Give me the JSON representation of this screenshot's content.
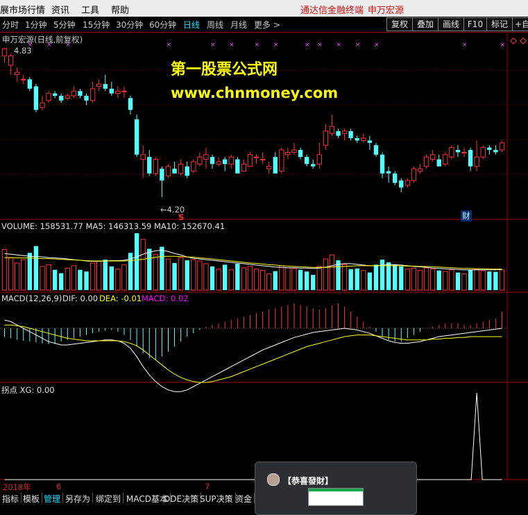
{
  "menubar": {
    "items": [
      "展市场行情",
      "资讯",
      "工具",
      "帮助"
    ],
    "right_items": [
      "通达信金融终端",
      "申万宏源"
    ]
  },
  "periods": {
    "items": [
      "分时",
      "1分钟",
      "5分钟",
      "15分钟",
      "30分钟",
      "60分钟",
      "日线",
      "周线",
      "月线",
      "更多 >"
    ],
    "active": "日线"
  },
  "right_buttons": [
    "复权",
    "叠加",
    "画线",
    "F10",
    "标记",
    "+自选"
  ],
  "price_panel": {
    "title": "申万宏源(日线,前复权)",
    "high_label": "4.83",
    "low_label": "←4.20",
    "s_marker": "S",
    "cai_badge": "财"
  },
  "watermark": {
    "line1": "第一股票公式网",
    "line2": "www.chnmoney.com"
  },
  "volume_panel": {
    "label": "VOLUME: 158531.77  MA5: 146313.59  MA10: 152670.41"
  },
  "macd_panel": {
    "name": "MACD(12,26,9)",
    "dif": "DIF: 0.00",
    "dea": "DEA: -0.01",
    "macd": "MACD: 0.02"
  },
  "xg_panel": {
    "label": "拐点  XG: 0.00"
  },
  "date_axis": {
    "year": "2018年",
    "month1": "6",
    "month2": "7"
  },
  "bottom_tabs": [
    "指标",
    "模板",
    "管理",
    "另存为",
    "绑定到",
    "MACD基本",
    "DDE决策",
    "SUP决策",
    "资金"
  ],
  "bottom_active": "管理",
  "popup": {
    "title": "【恭喜發財】"
  },
  "colors": {
    "up": "#ff3232",
    "down": "#54ffff",
    "ma5": "#ffffff",
    "ma10": "#ffff00",
    "macd_label": "#ff00ff",
    "grid": "#a00000"
  },
  "chart_data": {
    "type": "candlestick",
    "candles": [
      [
        4.8,
        4.83,
        4.82,
        4.77
      ],
      [
        4.76,
        4.8,
        4.81,
        4.72
      ],
      [
        4.72,
        4.73,
        4.75,
        4.69
      ],
      [
        4.7,
        4.7,
        4.72,
        4.68
      ],
      [
        4.7,
        4.66,
        4.71,
        4.65
      ],
      [
        4.67,
        4.57,
        4.68,
        4.56
      ],
      [
        4.58,
        4.6,
        4.63,
        4.57
      ],
      [
        4.61,
        4.64,
        4.65,
        4.6
      ],
      [
        4.64,
        4.63,
        4.65,
        4.62
      ],
      [
        4.63,
        4.61,
        4.64,
        4.6
      ],
      [
        4.62,
        4.63,
        4.64,
        4.61
      ],
      [
        4.63,
        4.65,
        4.67,
        4.62
      ],
      [
        4.65,
        4.63,
        4.66,
        4.62
      ],
      [
        4.63,
        4.61,
        4.64,
        4.59
      ],
      [
        4.61,
        4.66,
        4.69,
        4.6
      ],
      [
        4.67,
        4.68,
        4.7,
        4.65
      ],
      [
        4.68,
        4.66,
        4.72,
        4.65
      ],
      [
        4.66,
        4.64,
        4.69,
        4.63
      ],
      [
        4.64,
        4.65,
        4.67,
        4.62
      ],
      [
        4.65,
        4.65,
        4.67,
        4.62
      ],
      [
        4.62,
        4.57,
        4.63,
        4.55
      ],
      [
        4.53,
        4.38,
        4.55,
        4.37
      ],
      [
        4.36,
        4.38,
        4.42,
        4.28
      ],
      [
        4.37,
        4.3,
        4.4,
        4.29
      ],
      [
        4.3,
        4.36,
        4.37,
        4.29
      ],
      [
        4.32,
        4.27,
        4.33,
        4.2
      ],
      [
        4.29,
        4.33,
        4.34,
        4.28
      ],
      [
        4.32,
        4.3,
        4.35,
        4.3
      ],
      [
        4.3,
        4.34,
        4.36,
        4.29
      ],
      [
        4.33,
        4.29,
        4.35,
        4.28
      ],
      [
        4.31,
        4.35,
        4.36,
        4.3
      ],
      [
        4.34,
        4.37,
        4.39,
        4.33
      ],
      [
        4.36,
        4.38,
        4.41,
        4.32
      ],
      [
        4.37,
        4.34,
        4.38,
        4.32
      ],
      [
        4.34,
        4.35,
        4.37,
        4.33
      ],
      [
        4.36,
        4.34,
        4.37,
        4.31
      ],
      [
        4.34,
        4.37,
        4.38,
        4.32
      ],
      [
        4.36,
        4.3,
        4.37,
        4.3
      ],
      [
        4.31,
        4.34,
        4.36,
        4.31
      ],
      [
        4.33,
        4.38,
        4.39,
        4.33
      ],
      [
        4.37,
        4.37,
        4.38,
        4.34
      ],
      [
        4.36,
        4.36,
        4.39,
        4.34
      ],
      [
        4.32,
        4.33,
        4.35,
        4.3
      ],
      [
        4.37,
        4.3,
        4.39,
        4.3
      ],
      [
        4.31,
        4.4,
        4.41,
        4.3
      ],
      [
        4.38,
        4.39,
        4.41,
        4.36
      ],
      [
        4.39,
        4.4,
        4.43,
        4.38
      ],
      [
        4.4,
        4.37,
        4.41,
        4.36
      ],
      [
        4.37,
        4.34,
        4.38,
        4.33
      ],
      [
        4.34,
        4.33,
        4.36,
        4.32
      ],
      [
        4.34,
        4.38,
        4.43,
        4.32
      ],
      [
        4.42,
        4.48,
        4.51,
        4.4
      ],
      [
        4.47,
        4.5,
        4.55,
        4.46
      ],
      [
        4.48,
        4.46,
        4.49,
        4.45
      ],
      [
        4.47,
        4.48,
        4.49,
        4.44
      ],
      [
        4.48,
        4.45,
        4.49,
        4.44
      ],
      [
        4.45,
        4.44,
        4.46,
        4.43
      ],
      [
        4.44,
        4.45,
        4.47,
        4.43
      ],
      [
        4.44,
        4.43,
        4.46,
        4.4
      ],
      [
        4.42,
        4.38,
        4.43,
        4.37
      ],
      [
        4.38,
        4.3,
        4.39,
        4.28
      ],
      [
        4.31,
        4.3,
        4.33,
        4.26
      ],
      [
        4.3,
        4.26,
        4.31,
        4.25
      ],
      [
        4.27,
        4.24,
        4.28,
        4.22
      ],
      [
        4.25,
        4.27,
        4.28,
        4.24
      ],
      [
        4.27,
        4.32,
        4.33,
        4.26
      ],
      [
        4.31,
        4.32,
        4.34,
        4.3
      ],
      [
        4.33,
        4.37,
        4.38,
        4.32
      ],
      [
        4.36,
        4.38,
        4.4,
        4.35
      ],
      [
        4.36,
        4.33,
        4.38,
        4.33
      ],
      [
        4.34,
        4.38,
        4.39,
        4.33
      ],
      [
        4.37,
        4.41,
        4.42,
        4.36
      ],
      [
        4.4,
        4.39,
        4.42,
        4.37
      ],
      [
        4.39,
        4.39,
        4.41,
        4.37
      ],
      [
        4.4,
        4.33,
        4.41,
        4.31
      ],
      [
        4.33,
        4.37,
        4.44,
        4.31
      ],
      [
        4.37,
        4.41,
        4.42,
        4.36
      ],
      [
        4.41,
        4.4,
        4.42,
        4.38
      ],
      [
        4.4,
        4.39,
        4.42,
        4.38
      ],
      [
        4.4,
        4.43,
        4.44,
        4.39
      ]
    ],
    "volume": [
      120,
      95,
      80,
      90,
      110,
      130,
      70,
      75,
      60,
      50,
      65,
      72,
      60,
      55,
      80,
      85,
      90,
      70,
      62,
      75,
      110,
      168,
      150,
      122,
      105,
      128,
      92,
      80,
      96,
      88,
      90,
      86,
      78,
      70,
      62,
      75,
      60,
      78,
      66,
      70,
      62,
      58,
      48,
      56,
      72,
      66,
      64,
      60,
      55,
      45,
      70,
      92,
      104,
      88,
      76,
      62,
      64,
      58,
      52,
      75,
      90,
      82,
      76,
      70,
      62,
      65,
      58,
      66,
      62,
      58,
      55,
      60,
      52,
      48,
      60,
      62,
      58,
      55,
      54,
      60
    ],
    "ma5": [
      108,
      106,
      104,
      102,
      100,
      99,
      98,
      96,
      95,
      94,
      92,
      90,
      88,
      86,
      85,
      85,
      86,
      87,
      87,
      88,
      92,
      98,
      106,
      112,
      116,
      118,
      114,
      108,
      104,
      98,
      94,
      92,
      90,
      88,
      86,
      84,
      82,
      80,
      78,
      76,
      74,
      72,
      70,
      68,
      67,
      66,
      66,
      65,
      65,
      64,
      65,
      68,
      72,
      76,
      78,
      78,
      76,
      74,
      72,
      72,
      74,
      75,
      75,
      74,
      72,
      70,
      69,
      67,
      65,
      64,
      63,
      62,
      61,
      60,
      60,
      60,
      60,
      60,
      60,
      61
    ],
    "ma10": [
      96,
      96,
      95,
      95,
      95,
      94,
      93,
      93,
      92,
      91,
      90,
      89,
      88,
      87,
      86,
      86,
      86,
      86,
      86,
      86,
      87,
      89,
      91,
      94,
      97,
      99,
      100,
      100,
      99,
      98,
      97,
      95,
      94,
      92,
      90,
      88,
      86,
      84,
      82,
      80,
      79,
      77,
      75,
      74,
      72,
      71,
      70,
      69,
      68,
      67,
      67,
      67,
      68,
      69,
      70,
      71,
      72,
      72,
      72,
      72,
      72,
      72,
      72,
      72,
      71,
      71,
      70,
      70,
      69,
      68,
      67,
      66,
      65,
      64,
      64,
      63,
      63,
      62,
      62,
      62
    ],
    "macd_hist": [
      -0.01,
      -0.012,
      -0.014,
      -0.015,
      -0.016,
      -0.017,
      -0.018,
      -0.019,
      -0.018,
      -0.016,
      -0.014,
      -0.012,
      -0.01,
      -0.008,
      -0.006,
      -0.004,
      -0.003,
      -0.002,
      -0.004,
      -0.008,
      -0.014,
      -0.022,
      -0.03,
      -0.036,
      -0.038,
      -0.034,
      -0.028,
      -0.022,
      -0.016,
      -0.01,
      -0.006,
      -0.002,
      0.002,
      0.004,
      0.006,
      0.008,
      0.01,
      0.012,
      0.014,
      0.016,
      0.018,
      0.02,
      0.022,
      0.024,
      0.026,
      0.028,
      0.03,
      0.028,
      0.026,
      0.024,
      0.022,
      0.024,
      0.028,
      0.03,
      0.026,
      0.02,
      0.014,
      0.008,
      0.002,
      -0.004,
      -0.01,
      -0.014,
      -0.016,
      -0.016,
      -0.012,
      -0.008,
      -0.004,
      0.0,
      0.002,
      0.004,
      0.006,
      0.006,
      0.006,
      0.004,
      0.004,
      0.006,
      0.008,
      0.01,
      0.012,
      0.02
    ],
    "dif": [
      0.01,
      0.008,
      0.004,
      0.0,
      -0.004,
      -0.008,
      -0.012,
      -0.016,
      -0.018,
      -0.02,
      -0.02,
      -0.019,
      -0.018,
      -0.017,
      -0.016,
      -0.015,
      -0.014,
      -0.014,
      -0.015,
      -0.018,
      -0.024,
      -0.034,
      -0.046,
      -0.056,
      -0.064,
      -0.07,
      -0.074,
      -0.076,
      -0.076,
      -0.074,
      -0.07,
      -0.066,
      -0.062,
      -0.058,
      -0.054,
      -0.05,
      -0.046,
      -0.042,
      -0.038,
      -0.034,
      -0.03,
      -0.026,
      -0.023,
      -0.02,
      -0.017,
      -0.014,
      -0.011,
      -0.009,
      -0.007,
      -0.005,
      -0.004,
      -0.003,
      -0.002,
      -0.001,
      0.0,
      -0.001,
      -0.002,
      -0.004,
      -0.006,
      -0.009,
      -0.012,
      -0.015,
      -0.017,
      -0.018,
      -0.018,
      -0.017,
      -0.016,
      -0.014,
      -0.012,
      -0.01,
      -0.009,
      -0.008,
      -0.007,
      -0.006,
      -0.005,
      -0.004,
      -0.003,
      -0.002,
      -0.001,
      0.0
    ],
    "dea": [
      0.004,
      0.004,
      0.003,
      0.002,
      0.0,
      -0.002,
      -0.004,
      -0.006,
      -0.008,
      -0.01,
      -0.012,
      -0.013,
      -0.014,
      -0.015,
      -0.015,
      -0.015,
      -0.015,
      -0.015,
      -0.015,
      -0.016,
      -0.018,
      -0.021,
      -0.026,
      -0.032,
      -0.038,
      -0.044,
      -0.05,
      -0.055,
      -0.059,
      -0.062,
      -0.064,
      -0.065,
      -0.065,
      -0.064,
      -0.062,
      -0.06,
      -0.058,
      -0.055,
      -0.052,
      -0.049,
      -0.046,
      -0.043,
      -0.04,
      -0.037,
      -0.034,
      -0.031,
      -0.028,
      -0.025,
      -0.022,
      -0.02,
      -0.018,
      -0.016,
      -0.014,
      -0.012,
      -0.01,
      -0.009,
      -0.008,
      -0.008,
      -0.008,
      -0.009,
      -0.01,
      -0.011,
      -0.012,
      -0.013,
      -0.014,
      -0.014,
      -0.014,
      -0.014,
      -0.013,
      -0.013,
      -0.012,
      -0.012,
      -0.011,
      -0.011,
      -0.01,
      -0.01,
      -0.01,
      -0.01,
      -0.01,
      -0.01
    ],
    "xg": [
      0,
      0,
      0,
      0,
      0,
      0,
      0,
      0,
      0,
      0,
      0,
      0,
      0,
      0,
      0,
      0,
      0,
      0,
      0,
      0,
      0,
      0,
      0,
      0,
      0,
      0,
      0,
      0,
      0,
      0,
      0,
      0,
      0,
      0,
      0,
      0,
      0,
      0,
      0,
      0,
      0,
      0,
      0,
      0,
      0,
      0,
      0,
      0,
      0,
      0,
      0,
      0,
      0,
      0,
      0,
      0,
      0,
      0,
      0,
      0,
      0,
      0,
      0,
      0,
      0,
      0,
      0,
      0,
      0,
      0,
      0,
      0,
      0,
      0,
      0,
      1,
      0,
      0,
      0,
      0
    ],
    "price_range": [
      4.17,
      4.86
    ]
  }
}
